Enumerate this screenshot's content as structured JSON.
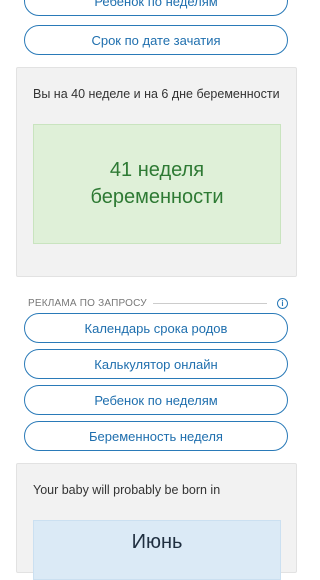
{
  "top_buttons": [
    {
      "label": "Ребенок по неделям"
    },
    {
      "label": "Срок по дате зачатия"
    }
  ],
  "result_card": {
    "text": "Вы на 40 неделе и на 6 дне беременности",
    "highlight_line1": "41 неделя",
    "highlight_line2": "беременности"
  },
  "ad_section": {
    "label": "РЕКЛАМА ПО ЗАПРОСУ",
    "info_icon": "info-icon",
    "links": [
      {
        "label": "Календарь срока родов"
      },
      {
        "label": "Калькулятор онлайн"
      },
      {
        "label": "Ребенок по неделям"
      },
      {
        "label": "Беременность неделя"
      }
    ]
  },
  "birth_card": {
    "text": "Your baby will probably be born in",
    "month": "Июнь"
  },
  "colors": {
    "accent": "#2a7ab8",
    "highlight_green_bg": "#dff0d8",
    "highlight_green_text": "#2e7a34",
    "highlight_blue_bg": "#dbeaf6"
  }
}
